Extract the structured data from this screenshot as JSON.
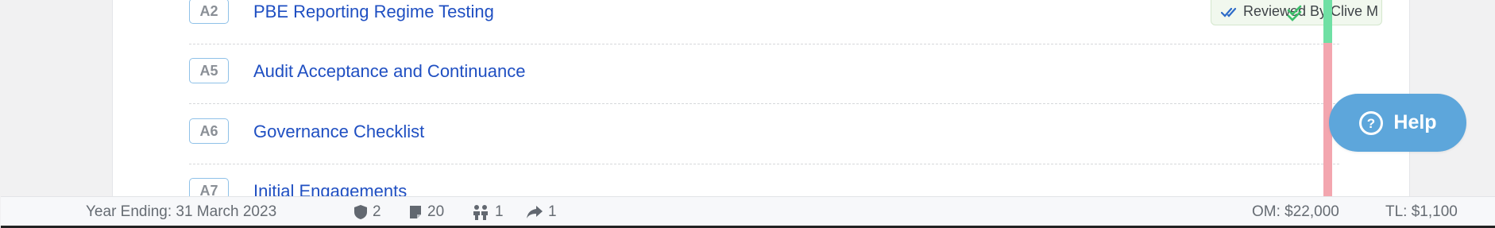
{
  "items": [
    {
      "code": "A2",
      "title": "PBE Reporting Regime Testing"
    },
    {
      "code": "A5",
      "title": "Audit Acceptance and Continuance"
    },
    {
      "code": "A6",
      "title": "Governance Checklist"
    },
    {
      "code": "A7",
      "title": "Initial Engagements"
    }
  ],
  "review_badge": {
    "label": "Reviewed By Clive M",
    "icon": "double-check-icon"
  },
  "status_colors": {
    "reviewed": "#6fe0a4",
    "pending": "#f3a6af"
  },
  "help": {
    "label": "Help",
    "icon": "question-circle-icon"
  },
  "statusbar": {
    "year_ending": "Year Ending: 31 March 2023",
    "shield_count": "2",
    "notes_count": "20",
    "people_count": "1",
    "share_count": "1",
    "om": "OM: $22,000",
    "tl": "TL: $1,100"
  }
}
